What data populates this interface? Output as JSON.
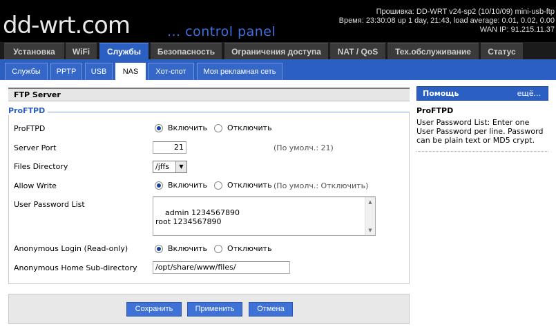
{
  "header": {
    "logo": "dd-wrt.com",
    "logo_sub": "... control panel",
    "firmware": "Прошивка: DD-WRT v24-sp2 (10/10/09) mini-usb-ftp",
    "uptime": "Время: 23:30:08 up 1 day, 21:43, load average: 0.01, 0.02, 0.00",
    "wan_ip": "WAN IP: 91.215.11.37"
  },
  "tabs": [
    "Установка",
    "WiFi",
    "Службы",
    "Безопасность",
    "Ограничения доступа",
    "NAT / QoS",
    "Тех.обслуживание",
    "Статус"
  ],
  "subtabs": [
    "Службы",
    "PPTP",
    "USB",
    "NAS",
    "Хот-спот",
    "Моя рекламная сеть"
  ],
  "panel": {
    "title": "FTP Server",
    "legend": "ProFTPD",
    "rows": {
      "proftpd": "ProFTPD",
      "server_port": "Server Port",
      "files_directory": "Files Directory",
      "allow_write": "Allow Write",
      "user_password_list": "User Password List",
      "anon_login": "Anonymous Login (Read-only)",
      "anon_home": "Anonymous Home Sub-directory"
    },
    "enable_label": "Включить",
    "disable_label": "Отключить",
    "server_port_value": "21",
    "server_port_hint": "(По умолч.: 21)",
    "files_directory_value": "/jffs",
    "allow_write_hint": "(По умолч.: Отключить)",
    "user_password_list_value": "admin 1234567890\nroot 1234567890",
    "anon_home_value": "/opt/share/www/files/",
    "radios": {
      "proftpd": "enable",
      "allow_write": "enable",
      "anon_login": "enable"
    }
  },
  "buttons": {
    "save": "Сохранить",
    "apply": "Применить",
    "cancel": "Отмена"
  },
  "help": {
    "header": "Помощь",
    "more": "ещё...",
    "title": "ProFTPD",
    "text": "User Password List: Enter one User Password per line. Password can be plain text or MD5 crypt."
  },
  "colors": {
    "accent": "#2b5fc2",
    "button": "#3f72d6",
    "header_bg": "#000000"
  }
}
